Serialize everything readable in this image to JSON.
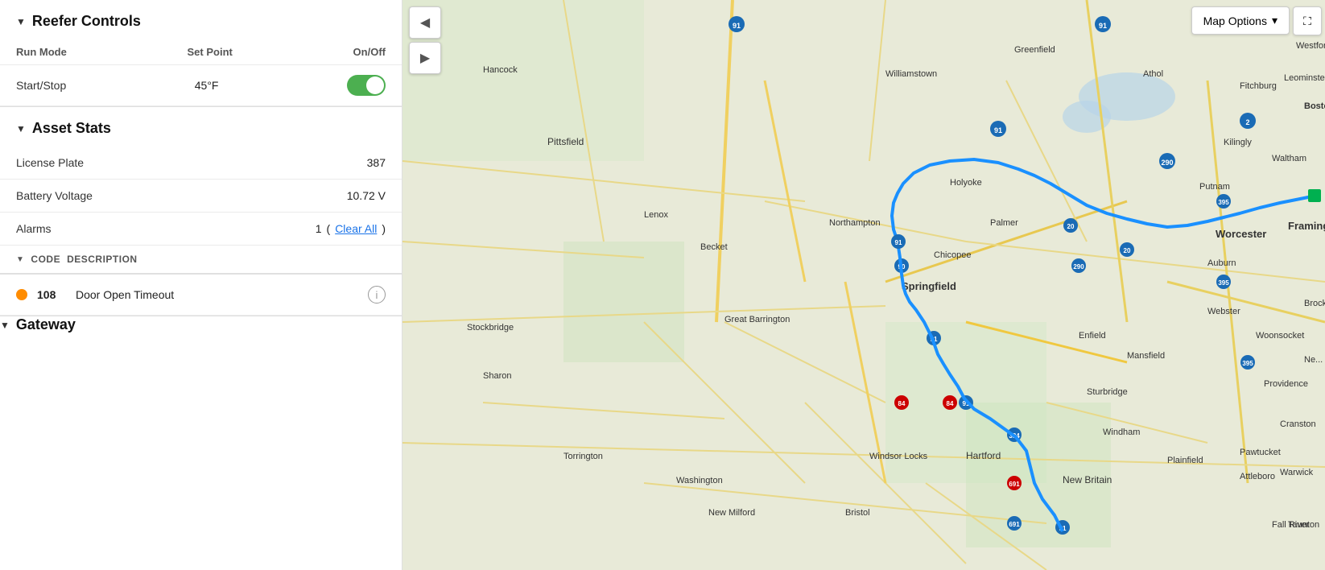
{
  "leftPanel": {
    "reefer": {
      "title": "Reefer Controls",
      "runMode": {
        "label": "Run Mode",
        "setPoint": "Set Point",
        "onOff": "On/Off"
      },
      "startStop": {
        "label": "Start/Stop",
        "value": "45°F",
        "toggleOn": true
      }
    },
    "assetStats": {
      "title": "Asset Stats",
      "items": [
        {
          "label": "License Plate",
          "value": "387"
        },
        {
          "label": "Battery Voltage",
          "value": "10.72 V"
        }
      ],
      "alarms": {
        "label": "Alarms",
        "count": "1",
        "clearAll": "Clear All"
      },
      "alarmsTable": {
        "columns": [
          "CODE",
          "DESCRIPTION"
        ],
        "rows": [
          {
            "dot": "orange",
            "code": "108",
            "description": "Door Open Timeout"
          }
        ]
      }
    },
    "gateway": {
      "title": "Gateway"
    }
  },
  "map": {
    "optionsLabel": "Map Options",
    "chevron": "▾"
  },
  "icons": {
    "collapse": "▼",
    "back": "◀",
    "play": "▶",
    "info": "i",
    "fullscreen": "⛶",
    "chevronDown": "▾"
  }
}
